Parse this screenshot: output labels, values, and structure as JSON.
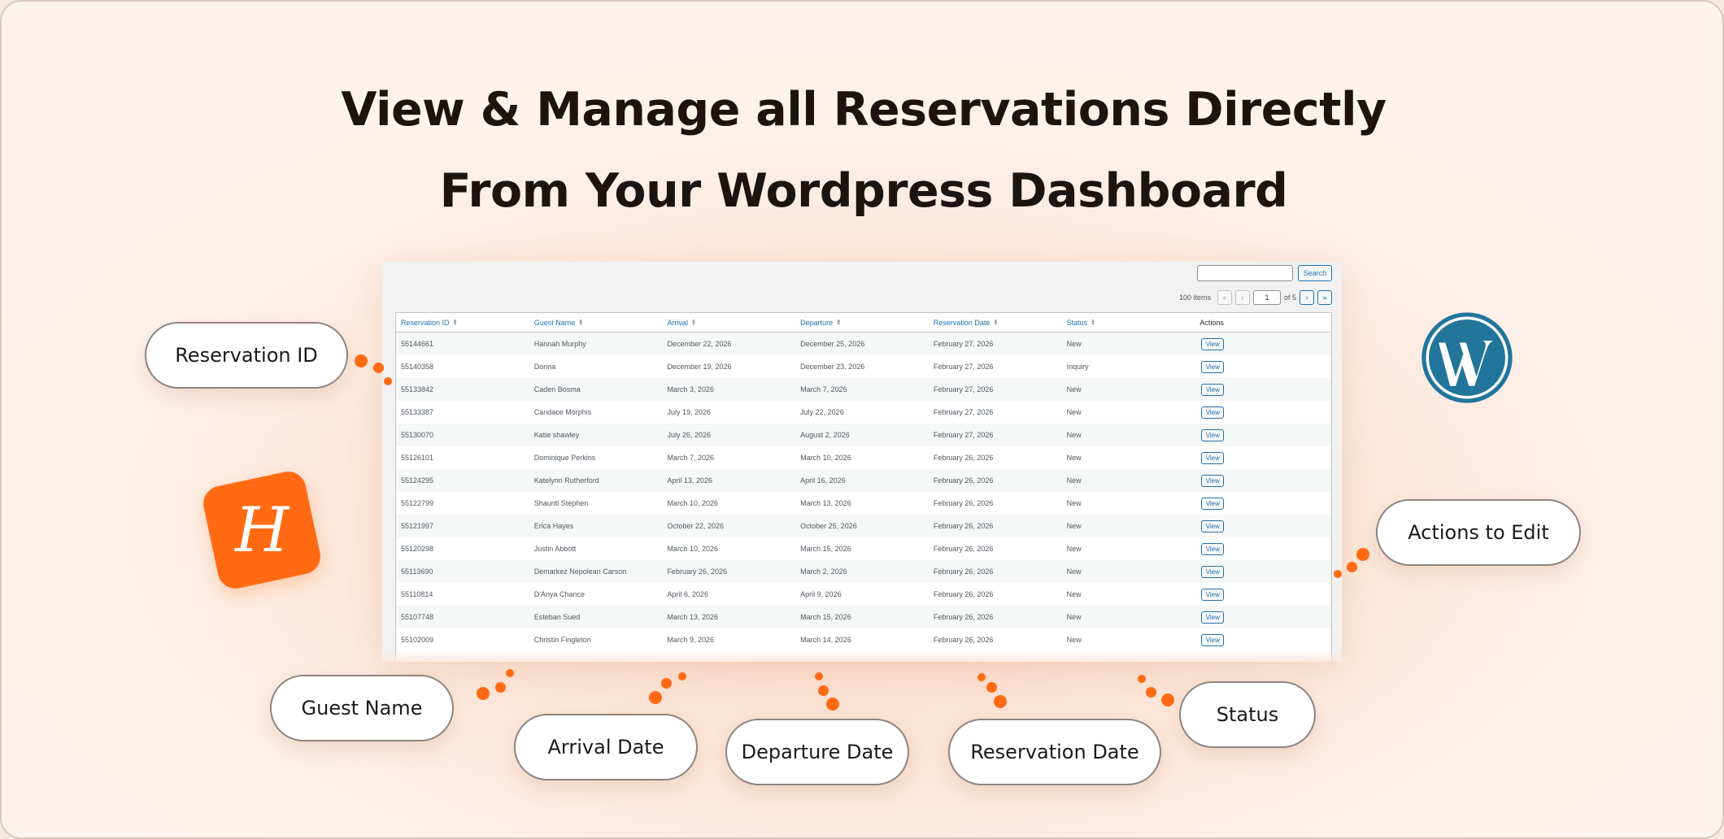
{
  "headline": {
    "line1": "View & Manage all Reservations Directly",
    "line2": "From Your Wordpress Dashboard"
  },
  "toolbar": {
    "search_value": "",
    "search_label": "Search"
  },
  "pagination": {
    "items_text": "100 items",
    "first": "«",
    "prev": "‹",
    "current_page": "1",
    "of_text": "of 5",
    "next": "›",
    "last": "»"
  },
  "table": {
    "columns": [
      "Reservation ID",
      "Guest Name",
      "Arrival",
      "Departure",
      "Reservation Date",
      "Status",
      "Actions"
    ],
    "view_label": "View",
    "rows": [
      {
        "id": "55144661",
        "guest": "Hannah Murphy",
        "arrival": "December 22, 2026",
        "departure": "December 25, 2026",
        "reserved": "February 27, 2026",
        "status": "New"
      },
      {
        "id": "55140358",
        "guest": "Donna",
        "arrival": "December 19, 2026",
        "departure": "December 23, 2026",
        "reserved": "February 27, 2026",
        "status": "Inquiry"
      },
      {
        "id": "55133842",
        "guest": "Caden Bosma",
        "arrival": "March 3, 2026",
        "departure": "March 7, 2026",
        "reserved": "February 27, 2026",
        "status": "New"
      },
      {
        "id": "55133387",
        "guest": "Candace Morphis",
        "arrival": "July 19, 2026",
        "departure": "July 22, 2026",
        "reserved": "February 27, 2026",
        "status": "New"
      },
      {
        "id": "55130070",
        "guest": "Katie shawley",
        "arrival": "July 26, 2026",
        "departure": "August 2, 2026",
        "reserved": "February 27, 2026",
        "status": "New"
      },
      {
        "id": "55126101",
        "guest": "Dominique Perkins",
        "arrival": "March 7, 2026",
        "departure": "March 10, 2026",
        "reserved": "February 26, 2026",
        "status": "New"
      },
      {
        "id": "55124295",
        "guest": "Katelynn Rutherford",
        "arrival": "April 13, 2026",
        "departure": "April 16, 2026",
        "reserved": "February 26, 2026",
        "status": "New"
      },
      {
        "id": "55122799",
        "guest": "Shaunti Stephen",
        "arrival": "March 10, 2026",
        "departure": "March 13, 2026",
        "reserved": "February 26, 2026",
        "status": "New"
      },
      {
        "id": "55121997",
        "guest": "Erica Hayes",
        "arrival": "October 22, 2026",
        "departure": "October 25, 2026",
        "reserved": "February 26, 2026",
        "status": "New"
      },
      {
        "id": "55120298",
        "guest": "Justin Abbott",
        "arrival": "March 10, 2026",
        "departure": "March 15, 2026",
        "reserved": "February 26, 2026",
        "status": "New"
      },
      {
        "id": "55113690",
        "guest": "Demarkez Nepolean Carson",
        "arrival": "February 26, 2026",
        "departure": "March 2, 2026",
        "reserved": "February 26, 2026",
        "status": "New"
      },
      {
        "id": "55110814",
        "guest": "D'Anya Chance",
        "arrival": "April 6, 2026",
        "departure": "April 9, 2026",
        "reserved": "February 26, 2026",
        "status": "New"
      },
      {
        "id": "55107748",
        "guest": "Esteban Sued",
        "arrival": "March 13, 2026",
        "departure": "March 15, 2026",
        "reserved": "February 26, 2026",
        "status": "New"
      },
      {
        "id": "55102009",
        "guest": "Christin Fingleton",
        "arrival": "March 9, 2026",
        "departure": "March 14, 2026",
        "reserved": "February 26, 2026",
        "status": "New"
      }
    ]
  },
  "callouts": {
    "reservation_id": "Reservation ID",
    "guest_name": "Guest Name",
    "arrival_date": "Arrival Date",
    "departure_date": "Departure Date",
    "reservation_date": "Reservation Date",
    "status": "Status",
    "actions": "Actions to Edit"
  },
  "logos": {
    "hostaway_icon": "hostaway-logo-icon",
    "hostaway_letter": "H",
    "wordpress_icon": "wordpress-logo-icon",
    "brand_orange": "#ff6a13",
    "wordpress_blue": "#21759b"
  },
  "colors": {
    "link_blue": "#2271b1",
    "accent_orange": "#ff6a13"
  }
}
